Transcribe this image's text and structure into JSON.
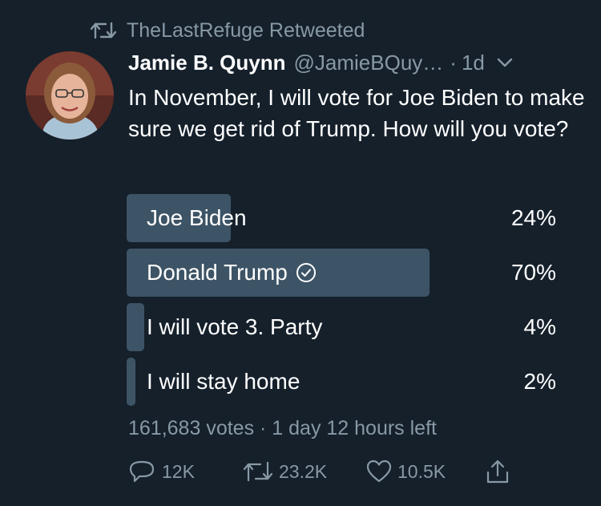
{
  "retweet_context": {
    "icon": "retweet-icon",
    "text": "TheLastRefuge Retweeted"
  },
  "tweet": {
    "author_name": "Jamie B. Quynn",
    "author_handle": "@JamieBQuy…",
    "dot": "·",
    "time_ago": "1d",
    "text": "In November, I will vote for Joe Biden to make sure we get rid of Trump. How will you vote?"
  },
  "poll": {
    "options": [
      {
        "label": "Joe Biden",
        "percent": "24%",
        "fill": 0.24,
        "selected": false
      },
      {
        "label": "Donald Trump",
        "percent": "70%",
        "fill": 0.7,
        "selected": true
      },
      {
        "label": "I will vote 3. Party",
        "percent": "4%",
        "fill": 0.04,
        "selected": false
      },
      {
        "label": "I will stay home",
        "percent": "2%",
        "fill": 0.02,
        "selected": false
      }
    ],
    "meta": "161,683 votes · 1 day 12 hours left"
  },
  "actions": {
    "reply_count": "12K",
    "retweet_count": "23.2K",
    "like_count": "10.5K"
  },
  "colors": {
    "background": "#15202b",
    "text_primary": "#ffffff",
    "text_secondary": "#8899a6",
    "poll_bar": "#3d5466"
  }
}
